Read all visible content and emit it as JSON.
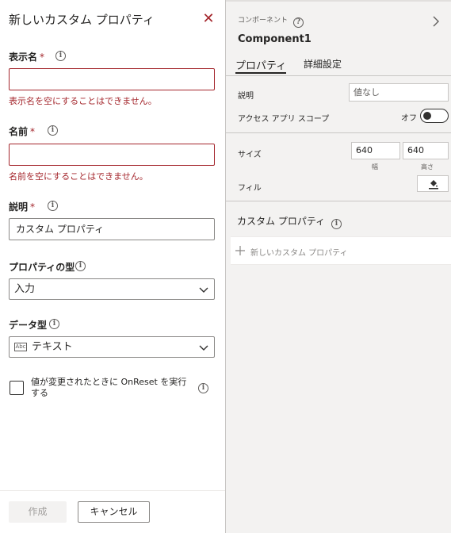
{
  "dialog": {
    "title": "新しいカスタム プロパティ",
    "display_name": {
      "label": "表示名",
      "required_mark": "*",
      "value": "",
      "error": "表示名を空にすることはできません。"
    },
    "name": {
      "label": "名前",
      "required_mark": "*",
      "value": "",
      "error": "名前を空にすることはできません。"
    },
    "description": {
      "label": "説明",
      "required_mark": "*",
      "value": "カスタム プロパティ"
    },
    "property_type": {
      "label": "プロパティの型",
      "selected": "入力"
    },
    "data_type": {
      "label": "データ型",
      "selected": "テキスト",
      "icon_text": "Abc"
    },
    "onreset_checkbox": {
      "label": "値が変更されたときに OnReset を実行する",
      "checked": false
    },
    "create_label": "作成",
    "cancel_label": "キャンセル"
  },
  "panel": {
    "kind_label": "コンポーネント",
    "component_name": "Component1",
    "tabs": [
      {
        "label": "プロパティ",
        "active": true
      },
      {
        "label": "詳細設定",
        "active": false
      }
    ],
    "description": {
      "label": "説明",
      "placeholder": "値なし"
    },
    "access_scope": {
      "label": "アクセス アプリ スコープ",
      "state": "オフ"
    },
    "size": {
      "label": "サイズ",
      "width": "640",
      "height": "640",
      "width_caption": "幅",
      "height_caption": "高さ"
    },
    "fill": {
      "label": "フィル"
    },
    "custom_properties": {
      "title": "カスタム プロパティ",
      "new_label": "新しいカスタム プロパティ"
    }
  },
  "colors": {
    "error": "#a4262c",
    "panel_bg": "#f3f2f1",
    "border": "#8a8886"
  }
}
